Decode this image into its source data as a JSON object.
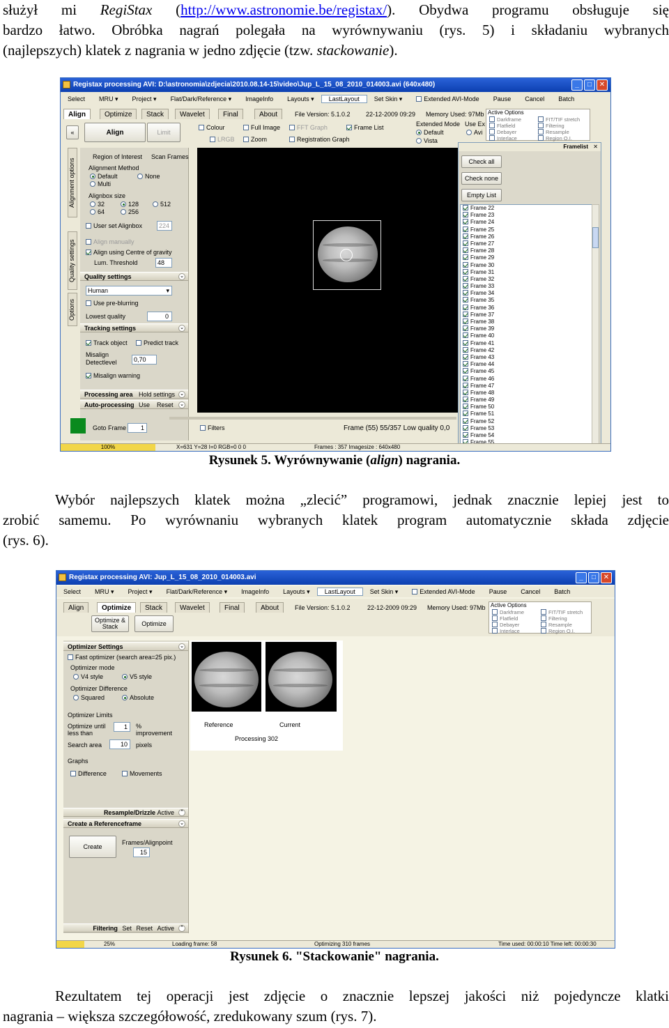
{
  "intro": {
    "line1_before": "służył mi ",
    "line1_app": "RegiStax",
    "line1_link_open": " (",
    "line1_link": "http://www.astronomie.be/registax/",
    "line1_after": "). Obydwa programu obsługuje się",
    "line2": "bardzo łatwo. Obróbka nagrań polegała na wyrównywaniu (rys. 5) i składaniu wybranych",
    "line3_before": "(najlepszych) klatek z nagrania w jedno zdjęcie (tzw. ",
    "line3_italic": "stackowanie",
    "line3_after": ")."
  },
  "figure5": {
    "title": "Registax processing AVI: D:\\astronomia\\zdjecia\\2010.08.14-15\\video\\Jup_L_15_08_2010_014003.avi (640x480)",
    "menu": [
      "Select",
      "MRU ▾",
      "Project ▾",
      "Flat/Dark/Reference ▾",
      "ImageInfo",
      "Layouts ▾",
      "LastLayout",
      "Set Skin ▾",
      "Extended AVI-Mode",
      "Pause",
      "Cancel",
      "Batch"
    ],
    "tabs": [
      "Align",
      "Optimize",
      "Stack",
      "Wavelet",
      "Final",
      "About"
    ],
    "file_version": "File Version: 5.1.0.2",
    "date": "22-12-2009 09:29",
    "memory": "Memory Used: 97Mb",
    "align_button": "Align",
    "limit_button": "Limit",
    "options": [
      "Colour",
      "Full Image",
      "FFT Graph",
      "Frame List",
      "LRGB",
      "Zoom",
      "Registration Graph"
    ],
    "extended_mode": "Extended Mode",
    "use_ex": "Use Ex",
    "default": "Default",
    "vista": "Vista",
    "avi": "Avi",
    "active_options": "Active Options",
    "active_opts": [
      "Darkframe",
      "Flatfield",
      "Debayer",
      "Interlace",
      "FIT/TIF stretch",
      "Filtering",
      "Resample",
      "Region O.I."
    ],
    "vertical_tabs": [
      "Alignment options",
      "Quality settings",
      "Options"
    ],
    "region_of_interest": "Region of Interest",
    "scan_frames": "Scan Frames",
    "alignment_method": "Alignment Method",
    "am_default": "Default",
    "am_none": "None",
    "am_multi": "Multi",
    "alignbox_size": "Alignbox size",
    "sizes": [
      "32",
      "128",
      "512",
      "64",
      "256"
    ],
    "user_set_alignbox": "User set Alignbox",
    "alignbox_value": "224",
    "align_manually": "Align manually",
    "align_centre": "Align using Centre of gravity",
    "lum_threshold": "Lum. Threshold",
    "lum_value": "48",
    "quality_settings": "Quality settings",
    "quality_mode": "Human",
    "use_preblurring": "Use pre-blurring",
    "lowest_quality": "Lowest quality",
    "lowest_value": "0",
    "tracking_settings": "Tracking settings",
    "track_object": "Track object",
    "predict_track": "Predict track",
    "misalign": "Misalign",
    "detectlevel": "Detectlevel",
    "misalign_value": "0,70",
    "misalign_warning": "Misalign warning",
    "processing_area": "Processing area",
    "hold_settings": "Hold settings",
    "auto_processing": "Auto-processing",
    "use": "Use",
    "reset": "Reset",
    "goto_frame": "Goto Frame",
    "goto_value": "1",
    "filters": "Filters",
    "frame_info": "Frame (55)  55/357  Low quality 0,0",
    "framelist_title": "Framelist",
    "check_all": "Check all",
    "check_none": "Check none",
    "empty_list": "Empty List",
    "frames": [
      "Frame 22",
      "Frame 23",
      "Frame 24",
      "Frame 25",
      "Frame 26",
      "Frame 27",
      "Frame 28",
      "Frame 29",
      "Frame 30",
      "Frame 31",
      "Frame 32",
      "Frame 33",
      "Frame 34",
      "Frame 35",
      "Frame 36",
      "Frame 37",
      "Frame 38",
      "Frame 39",
      "Frame 40",
      "Frame 41",
      "Frame 42",
      "Frame 43",
      "Frame 44",
      "Frame 45",
      "Frame 46",
      "Frame 47",
      "Frame 48",
      "Frame 49",
      "Frame 50",
      "Frame 51",
      "Frame 52",
      "Frame 53",
      "Frame 54",
      "Frame 55"
    ],
    "progress": "100%",
    "progress_fraction": 1.0,
    "coords": "X=631 Y=28 I=0 RGB=0 0 0",
    "frames_info": "Frames : 357 Imagesize : 640x480",
    "caption_before": "Rysunek 5. Wyrównywanie (",
    "caption_italic": "align",
    "caption_after": ") nagrania."
  },
  "middle": {
    "line1": "Wybór najlepszych klatek można „zlecić” programowi, jednak znacznie lepiej jest to",
    "line2": "zrobić samemu. Po wyrównaniu wybranych klatek program automatycznie składa zdjęcie",
    "line3": "(rys. 6)."
  },
  "figure6": {
    "title": "Registax processing AVI: Jup_L_15_08_2010_014003.avi",
    "menu": [
      "Select",
      "MRU ▾",
      "Project ▾",
      "Flat/Dark/Reference ▾",
      "ImageInfo",
      "Layouts ▾",
      "LastLayout",
      "Set Skin ▾",
      "Extended AVI-Mode",
      "Pause",
      "Cancel",
      "Batch"
    ],
    "tabs": [
      "Align",
      "Optimize",
      "Stack",
      "Wavelet",
      "Final",
      "About"
    ],
    "file_version": "File Version: 5.1.0.2",
    "date": "22-12-2009 09:29",
    "memory": "Memory Used: 97Mb",
    "optimize_stack": "Optimize & Stack",
    "optimize": "Optimize",
    "active_options": "Active Options",
    "active_opts": [
      "Darkframe",
      "Flatfield",
      "Debayer",
      "Interlace",
      "FIT/TIF stretch",
      "Filtering",
      "Resample",
      "Region O.I."
    ],
    "optimizer_settings": "Optimizer Settings",
    "fast_optimizer": "Fast optimizer (search area=25 pix.)",
    "optimizer_mode": "Optimizer mode",
    "v4_style": "V4 style",
    "v5_style": "V5 style",
    "optimizer_difference": "Optimizer Difference",
    "squared": "Squared",
    "absolute": "Absolute",
    "optimizer_limits": "Optimizer Limits",
    "optimize_until": "Optimize until",
    "less_than": "less than",
    "until_value": "1",
    "percent": "%",
    "improvement": "improvement",
    "search_area": "Search area",
    "search_value": "10",
    "pixels": "pixels",
    "graphs": "Graphs",
    "difference": "Difference",
    "movements": "Movements",
    "resample_drizzle": "Resample/Drizzle",
    "active": "Active",
    "create_reference": "Create a Referenceframe",
    "create": "Create",
    "frames_alignpoint": "Frames/Alignpoint",
    "frames_value": "15",
    "filtering": "Filtering",
    "set": "Set",
    "reset": "Reset",
    "reference": "Reference",
    "current": "Current",
    "processing": "Processing 302",
    "progress": "25%",
    "progress_fraction": 0.25,
    "loading_frame": "Loading frame: 58",
    "optimizing": "Optimizing 310 frames",
    "time_used": "Time used: 00:00:10 Time left: 00:00:30",
    "caption": "Rysunek 6. \"Stackowanie\" nagrania."
  },
  "outro": {
    "line1": "Rezultatem tej operacji jest zdjęcie o znacznie lepszej jakości niż pojedyncze klatki",
    "line2": "nagrania – większa szczegółowość, zredukowany szum (rys. 7)."
  }
}
